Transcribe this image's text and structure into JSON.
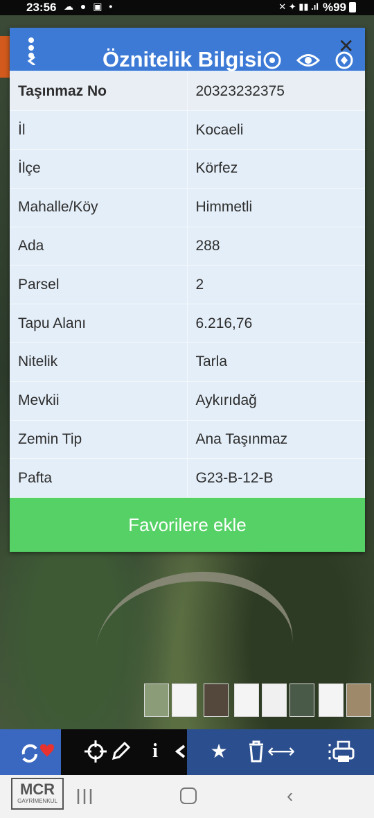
{
  "status_bar": {
    "time": "23:56",
    "battery": "%99"
  },
  "dialog": {
    "title": "Öznitelik Bilgisi",
    "rows": [
      {
        "key": "Taşınmaz No",
        "value": "20323232375"
      },
      {
        "key": "İl",
        "value": "Kocaeli"
      },
      {
        "key": "İlçe",
        "value": "Körfez"
      },
      {
        "key": "Mahalle/Köy",
        "value": "Himmetli"
      },
      {
        "key": "Ada",
        "value": "288"
      },
      {
        "key": "Parsel",
        "value": "2"
      },
      {
        "key": "Tapu Alanı",
        "value": "6.216,76"
      },
      {
        "key": "Nitelik",
        "value": "Tarla"
      },
      {
        "key": "Mevkii",
        "value": "Aykırıdağ"
      },
      {
        "key": "Zemin Tip",
        "value": "Ana Taşınmaz"
      },
      {
        "key": "Pafta",
        "value": "G23-B-12-B"
      }
    ],
    "favorite_button": "Favorilere ekle"
  },
  "watermark": {
    "logo": "MCR",
    "sub": "GAYRİMENKUL"
  },
  "colors": {
    "header_blue": "#3d7ad6",
    "favorite_green": "#56d166",
    "toolbar_blue": "#2b4f8e",
    "heart_red": "#e8322f"
  },
  "icons": [
    "menu-icon",
    "refresh-heart-icon",
    "crosshair-icon",
    "pencil-icon",
    "info-icon",
    "share-icon",
    "star-icon",
    "trash-icon",
    "arrows-icon",
    "more-icon",
    "print-icon",
    "eye-icon",
    "location-icon",
    "close-icon"
  ]
}
